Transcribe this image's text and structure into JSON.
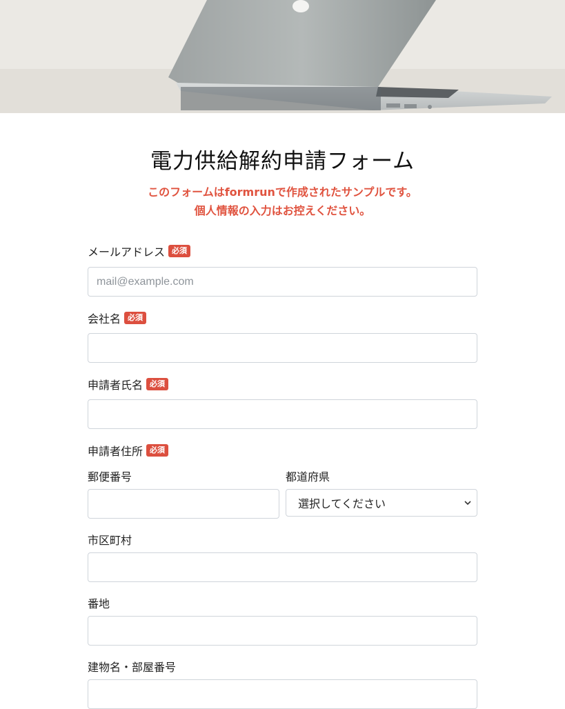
{
  "form": {
    "title": "電力供給解約申請フォーム",
    "notice_line1": "このフォームはformrunで作成されたサンプルです。",
    "notice_line2": "個人情報の入力はお控えください。",
    "required_badge": "必須"
  },
  "fields": {
    "email": {
      "label": "メールアドレス",
      "placeholder": "mail@example.com",
      "value": ""
    },
    "company": {
      "label": "会社名",
      "value": ""
    },
    "applicant_name": {
      "label": "申請者氏名",
      "value": ""
    },
    "address": {
      "label": "申請者住所",
      "postal_code": {
        "label": "郵便番号",
        "value": ""
      },
      "prefecture": {
        "label": "都道府県",
        "selected": "選択してください"
      },
      "city": {
        "label": "市区町村",
        "value": ""
      },
      "street": {
        "label": "番地",
        "value": ""
      },
      "building": {
        "label": "建物名・部屋番号",
        "value": ""
      }
    }
  },
  "colors": {
    "accent": "#e0533f",
    "badge": "#dc4f3f",
    "input_border": "#cfd4da"
  }
}
